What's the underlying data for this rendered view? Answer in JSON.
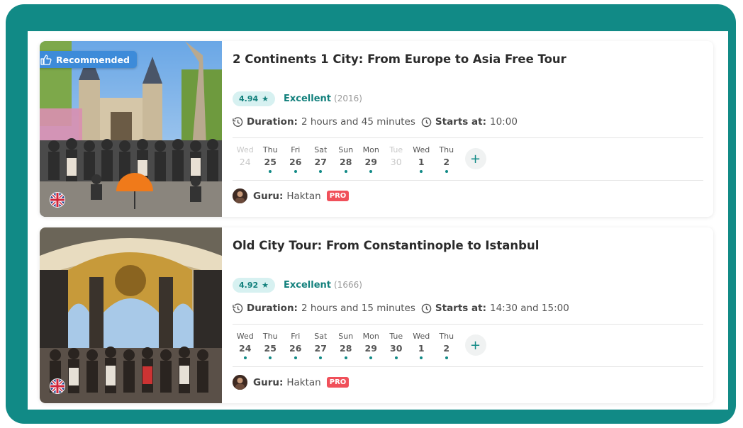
{
  "recommended_label": "Recommended",
  "tours": [
    {
      "title": "2 Continents 1 City: From Europe to Asia Free Tour",
      "score": "4.94",
      "rating_label": "Excellent",
      "reviews": "(2016)",
      "duration_label": "Duration:",
      "duration": "2 hours and 45 minutes",
      "starts_label": "Starts at:",
      "starts": "10:00",
      "days": [
        {
          "name": "Wed",
          "date": "24",
          "available": false
        },
        {
          "name": "Thu",
          "date": "25",
          "available": true
        },
        {
          "name": "Fri",
          "date": "26",
          "available": true
        },
        {
          "name": "Sat",
          "date": "27",
          "available": true
        },
        {
          "name": "Sun",
          "date": "28",
          "available": true
        },
        {
          "name": "Mon",
          "date": "29",
          "available": true
        },
        {
          "name": "Tue",
          "date": "30",
          "available": false
        },
        {
          "name": "Wed",
          "date": "1",
          "available": true
        },
        {
          "name": "Thu",
          "date": "2",
          "available": true
        }
      ],
      "guru_label": "Guru:",
      "guru_name": "Haktan",
      "pro_label": "PRO"
    },
    {
      "title": "Old City Tour: From Constantinople to Istanbul",
      "score": "4.92",
      "rating_label": "Excellent",
      "reviews": "(1666)",
      "duration_label": "Duration:",
      "duration": "2 hours and 15 minutes",
      "starts_label": "Starts at:",
      "starts": "14:30 and 15:00",
      "days": [
        {
          "name": "Wed",
          "date": "24",
          "available": true
        },
        {
          "name": "Thu",
          "date": "25",
          "available": true
        },
        {
          "name": "Fri",
          "date": "26",
          "available": true
        },
        {
          "name": "Sat",
          "date": "27",
          "available": true
        },
        {
          "name": "Sun",
          "date": "28",
          "available": true
        },
        {
          "name": "Mon",
          "date": "29",
          "available": true
        },
        {
          "name": "Tue",
          "date": "30",
          "available": true
        },
        {
          "name": "Wed",
          "date": "1",
          "available": true
        },
        {
          "name": "Thu",
          "date": "2",
          "available": true
        }
      ],
      "guru_label": "Guru:",
      "guru_name": "Haktan",
      "pro_label": "PRO"
    }
  ],
  "colors": {
    "frame": "#118a86",
    "accent": "#12807c",
    "badge": "#3d8bd9",
    "pro": "#f0505a"
  }
}
